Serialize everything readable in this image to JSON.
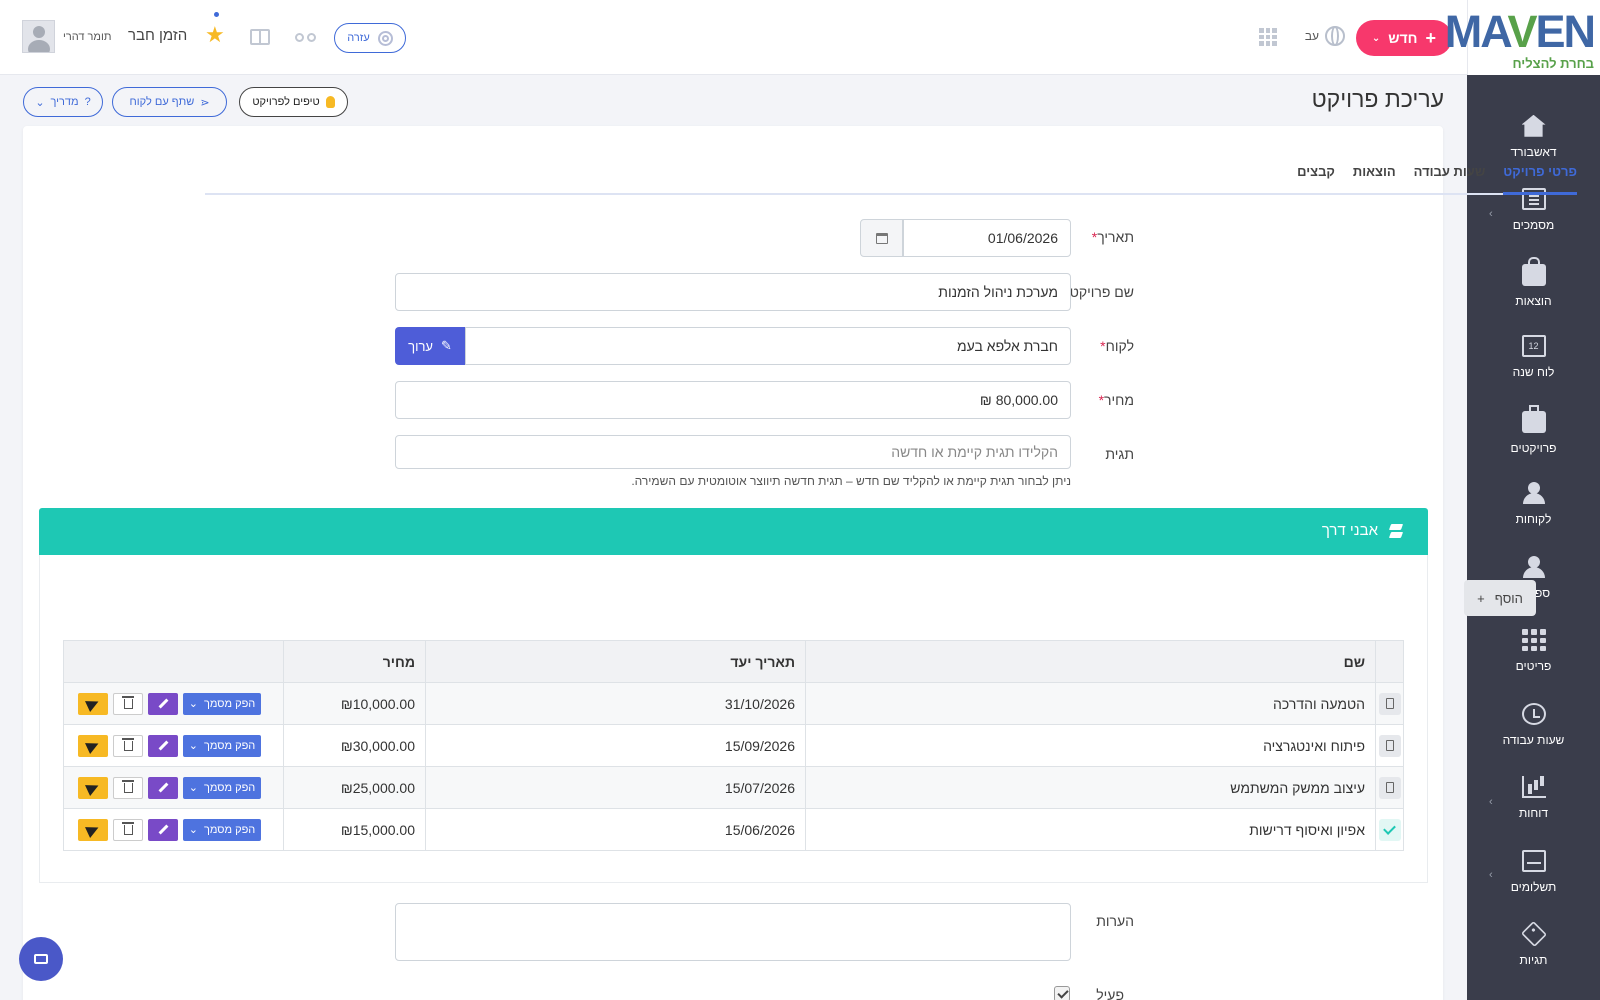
{
  "topbar": {
    "new_label": "חדש",
    "lang_label": "עב",
    "invite_label": "הזמן חבר",
    "user_name": "תומר דהרי",
    "help_label": "עזרה"
  },
  "logo": {
    "main": "MAVEN",
    "sub": "בחרת להצליח"
  },
  "sidebar": {
    "items": [
      {
        "label": "דאשבורד",
        "icon": "home-icon"
      },
      {
        "label": "מסמכים",
        "icon": "documents-icon"
      },
      {
        "label": "הוצאות",
        "icon": "shopping-bag-icon"
      },
      {
        "label": "לוח שנה",
        "icon": "calendar-icon"
      },
      {
        "label": "פרויקטים",
        "icon": "briefcase-icon"
      },
      {
        "label": "לקוחות",
        "icon": "user-icon"
      },
      {
        "label": "ספקים",
        "icon": "user-icon"
      },
      {
        "label": "פריטים",
        "icon": "grid-icon"
      },
      {
        "label": "שעות עבודה",
        "icon": "clock-history-icon"
      },
      {
        "label": "דוחות",
        "icon": "chart-icon"
      },
      {
        "label": "תשלומים",
        "icon": "inbox-icon"
      },
      {
        "label": "תגיות",
        "icon": "tag-icon"
      }
    ]
  },
  "page": {
    "title": "עריכת פרויקט",
    "tips_label": "טיפים לפרויקט",
    "share_label": "שתף עם לקוח",
    "guide_label": "מדריך"
  },
  "tabs": [
    {
      "label": "פרטי פרויקט",
      "active": true
    },
    {
      "label": "שעות עבודה",
      "active": false
    },
    {
      "label": "הוצאות",
      "active": false
    },
    {
      "label": "קבצים",
      "active": false
    }
  ],
  "form": {
    "date_label": "תאריך",
    "date_value": "01/06/2026",
    "name_label": "שם פרויקט",
    "name_value": "מערכת ניהול הזמנות",
    "client_label": "לקוח",
    "client_value": "חברת אלפא בעמ",
    "client_edit_label": "ערוך",
    "price_label": "מחיר",
    "price_value": "80,000.00 ₪",
    "tag_label": "תגית",
    "tag_placeholder": "הקלידו תגית קיימת או חדשה",
    "tag_hint": "ניתן לבחור תגית קיימת או להקליד שם חדש – תגית חדשה תיווצר אוטומטית עם השמירה.",
    "notes_label": "הערות",
    "active_label": "פעיל",
    "required_mark": "*"
  },
  "milestones": {
    "title": "אבני דרך",
    "add_label": "הוסף",
    "columns": [
      "שם",
      "תאריך יעד",
      "מחיר"
    ],
    "action_doc_label": "הפק מסמך",
    "rows": [
      {
        "name": "הטמעה והדרכה",
        "date": "31/10/2026",
        "price": "₪10,000.00",
        "done": false
      },
      {
        "name": "פיתוח ואינטגרציה",
        "date": "15/09/2026",
        "price": "₪30,000.00",
        "done": false
      },
      {
        "name": "עיצוב ממשק המשתמש",
        "date": "15/07/2026",
        "price": "₪25,000.00",
        "done": false
      },
      {
        "name": "אפיון ואיסוף דרישות",
        "date": "15/06/2026",
        "price": "₪15,000.00",
        "done": true
      }
    ]
  },
  "colors": {
    "accent": "#3f6ad8",
    "new_button": "#f7386c",
    "milestone_header": "#1ec8b4",
    "sidebar": "#3a3d4b",
    "send_action": "#f7b924",
    "edit_action": "#794ac7"
  }
}
